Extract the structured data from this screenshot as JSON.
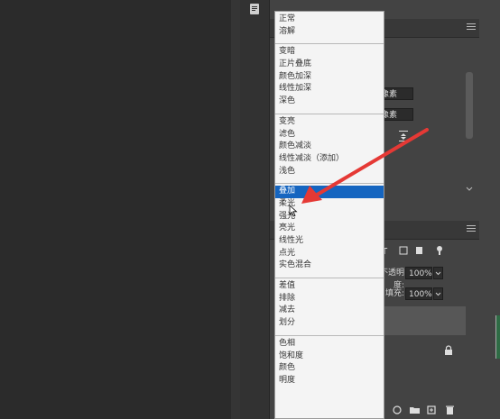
{
  "blend_menu": {
    "groups": [
      [
        "正常",
        "溶解"
      ],
      [
        "变暗",
        "正片叠底",
        "颜色加深",
        "线性加深",
        "深色"
      ],
      [
        "变亮",
        "滤色",
        "颜色减淡",
        "线性减淡（添加）",
        "浅色"
      ],
      [
        "叠加",
        "柔光",
        "强光",
        "亮光",
        "线性光",
        "点光",
        "实色混合"
      ],
      [
        "差值",
        "排除",
        "减去",
        "划分"
      ],
      [
        "色相",
        "饱和度",
        "颜色",
        "明度"
      ]
    ],
    "selected": "叠加"
  },
  "properties_panel": {
    "field1_value": "像素",
    "field2_value": "像素"
  },
  "layers_panel": {
    "opacity_label": "不透明度:",
    "opacity_value": "100%",
    "fill_label": "填充:",
    "fill_value": "100%"
  },
  "icons": {
    "tool_button": "notes-icon",
    "lock": "lock-icon"
  },
  "colors": {
    "selection": "#1565c0",
    "arrow": "#e53935",
    "menu_bg": "#f4f4f4"
  }
}
